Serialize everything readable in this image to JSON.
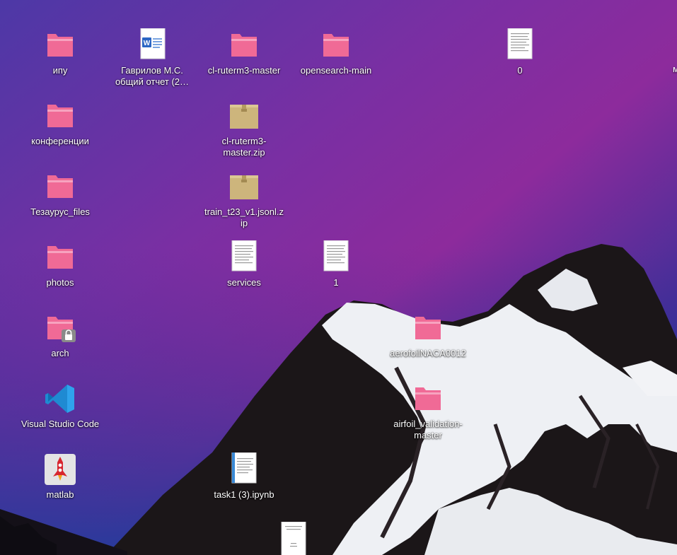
{
  "desktop": {
    "icons": [
      {
        "id": "ipu",
        "label": "ипу",
        "type": "folder"
      },
      {
        "id": "gavrilov",
        "label": "Гаврилов М.С. общий отчет (2…",
        "type": "word-doc"
      },
      {
        "id": "cl-ruterm3-master",
        "label": "cl-ruterm3-master",
        "type": "folder"
      },
      {
        "id": "opensearch-main",
        "label": "opensearch-main",
        "type": "folder"
      },
      {
        "id": "zero",
        "label": "0",
        "type": "text-doc"
      },
      {
        "id": "konferencii",
        "label": "конференции",
        "type": "folder"
      },
      {
        "id": "cl-ruterm3-zip",
        "label": "cl-ruterm3-master.zip",
        "type": "archive"
      },
      {
        "id": "tezaurus",
        "label": "Тезаурус_files",
        "type": "folder"
      },
      {
        "id": "train-zip",
        "label": "train_t23_v1.jsonl.zip",
        "type": "archive"
      },
      {
        "id": "photos",
        "label": "photos",
        "type": "folder"
      },
      {
        "id": "services",
        "label": "services",
        "type": "text-doc"
      },
      {
        "id": "one",
        "label": "1",
        "type": "text-doc"
      },
      {
        "id": "arch",
        "label": "arch",
        "type": "folder-locked"
      },
      {
        "id": "aerofoil",
        "label": "aerofoilNACA0012",
        "type": "folder"
      },
      {
        "id": "vscode",
        "label": "Visual Studio Code",
        "type": "vscode"
      },
      {
        "id": "airfoil-validation",
        "label": "airfoil_validation-master",
        "type": "folder"
      },
      {
        "id": "matlab",
        "label": "matlab",
        "type": "matlab"
      },
      {
        "id": "task1",
        "label": "task1 (3).ipynb",
        "type": "notebook"
      },
      {
        "id": "bottom-doc",
        "label": "",
        "type": "pdf-doc"
      }
    ],
    "edge_label": "м"
  },
  "colors": {
    "folder": "#f06a96",
    "folder_tab": "#f7a3bf",
    "archive": "#cdb57c",
    "sky_top": "#5a38a8",
    "sky_mid": "#8a2da0",
    "sky_bottom": "#2a3a9a",
    "mountain": "#1b1618",
    "snow": "#eef0f4"
  }
}
